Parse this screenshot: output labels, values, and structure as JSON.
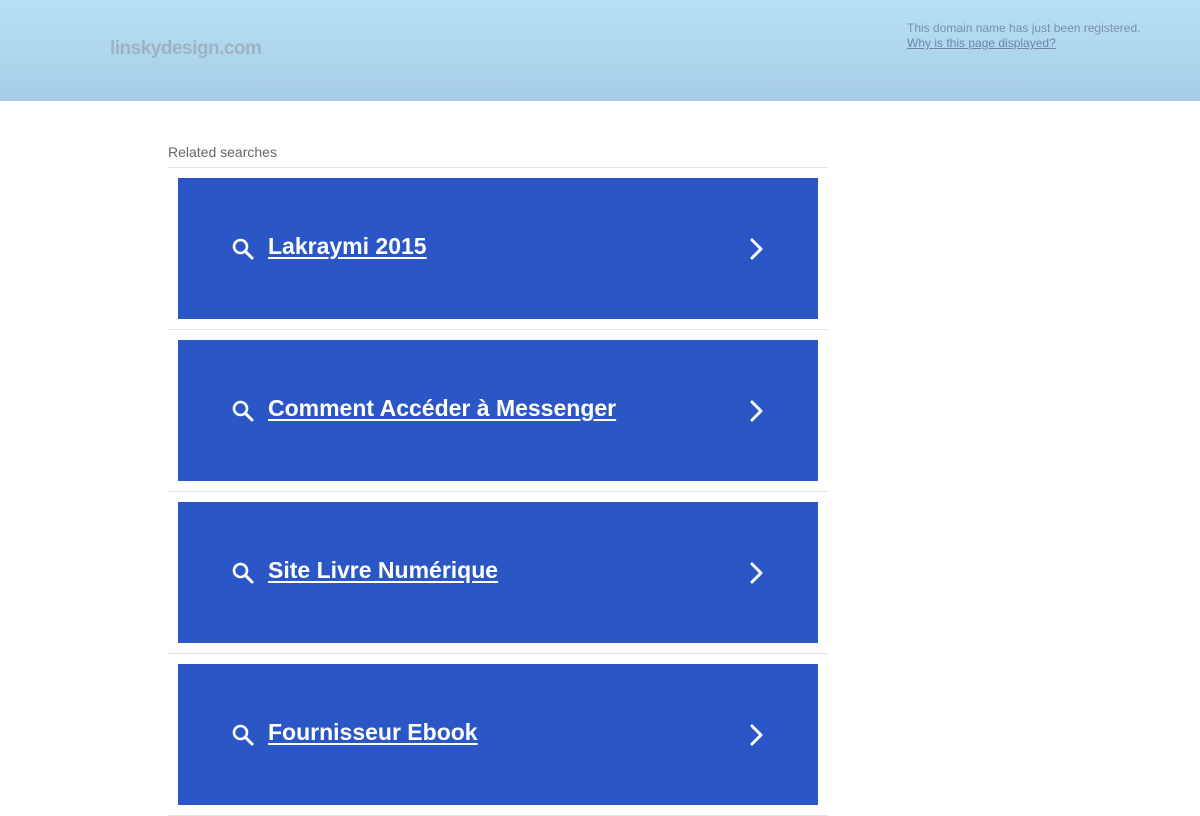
{
  "header": {
    "domain": "linskydesign.com",
    "notice_text": "This domain name has just been registered.",
    "notice_link": "Why is this page displayed?"
  },
  "related": {
    "heading": "Related searches",
    "items": [
      {
        "label": "Lakraymi 2015"
      },
      {
        "label": "Comment Accéder à Messenger"
      },
      {
        "label": "Site Livre Numérique"
      },
      {
        "label": "Fournisseur Ebook"
      }
    ]
  },
  "colors": {
    "header_top": "#b8e0f4",
    "header_bottom": "#a6cde6",
    "result_bg": "#2b57c6",
    "result_text": "#ffffff"
  },
  "icons": {
    "search": "search-icon",
    "chevron": "chevron-right-icon"
  }
}
